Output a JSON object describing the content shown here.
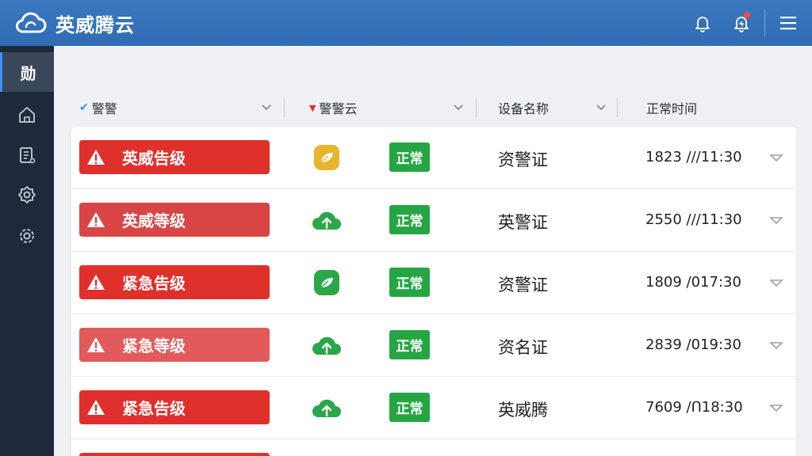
{
  "header": {
    "app_title": "英威腾云",
    "icons": [
      "cloud-logo-icon",
      "bell-icon",
      "bell-alert-icon",
      "menu-icon"
    ],
    "colors": {
      "bar": "#2f6cb3",
      "badge_dot": "#ff4a3d"
    }
  },
  "sidebar": {
    "active_label": "勋",
    "items": [
      "active-glyph",
      "home-icon",
      "document-icon",
      "gear-badge-icon",
      "settings-icon"
    ]
  },
  "table": {
    "columns": [
      {
        "mark": "✔",
        "label": "警警"
      },
      {
        "mark": "▼",
        "label": "警警云"
      },
      {
        "mark": "",
        "label": "设备名称"
      },
      {
        "mark": "",
        "label": "正常时间"
      }
    ],
    "rows": [
      {
        "alarm": "英威告级",
        "alarm_color": "#e0302b",
        "cloud_icon": "yellow-leaf-cloud-icon",
        "status": "正常",
        "device": "资警证",
        "time": "1823 ///11:30"
      },
      {
        "alarm": "英威等级",
        "alarm_color": "#d94545",
        "cloud_icon": "green-upload-cloud-icon",
        "status": "正常",
        "device": "英警证",
        "time": "2550 ///11:30"
      },
      {
        "alarm": "紧急告级",
        "alarm_color": "#e0302b",
        "cloud_icon": "green-leaf-cloud-icon",
        "status": "正常",
        "device": "资警证",
        "time": "1809 /017:30"
      },
      {
        "alarm": "紧急等级",
        "alarm_color": "#e35a5a",
        "cloud_icon": "green-upload-cloud-icon",
        "status": "正常",
        "device": "资名证",
        "time": "2839 /019:30"
      },
      {
        "alarm": "紧急告级",
        "alarm_color": "#e0302b",
        "cloud_icon": "green-upload-cloud-icon",
        "status": "正常",
        "device": "英威腾",
        "time": "7609 /Ո18:30"
      }
    ],
    "colors": {
      "status_ok": "#25a544",
      "leaf_yellow": "#e8b52e",
      "cloud_green": "#2aa748"
    }
  }
}
